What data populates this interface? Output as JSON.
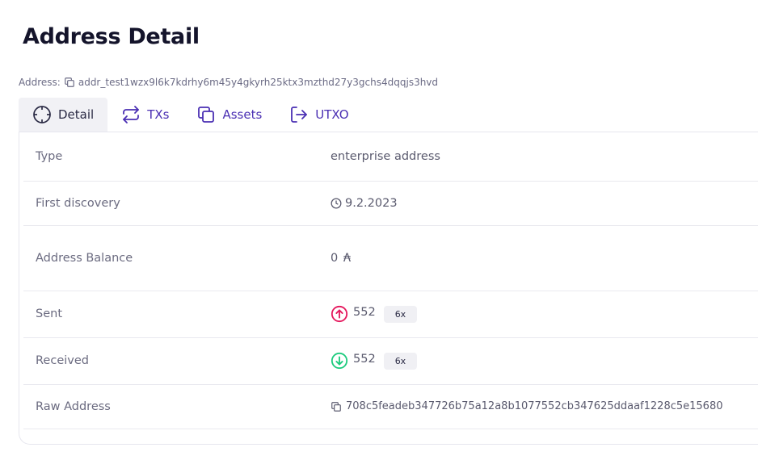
{
  "page": {
    "title": "Address Detail"
  },
  "address": {
    "label": "Address:",
    "value": "addr_test1wzx9l6k7kdrhy6m45y4gkyrh25ktx3mzthd27y3gchs4dqqjs3hvd"
  },
  "tabs": [
    {
      "label": "Detail",
      "icon": "crosshair-icon",
      "active": true
    },
    {
      "label": "TXs",
      "icon": "repeat-icon",
      "active": false
    },
    {
      "label": "Assets",
      "icon": "copy-stack-icon",
      "active": false
    },
    {
      "label": "UTXO",
      "icon": "log-out-icon",
      "active": false
    }
  ],
  "details": {
    "type": {
      "label": "Type",
      "value": "enterprise address"
    },
    "first_discovery": {
      "label": "First discovery",
      "value": "9.2.2023"
    },
    "balance": {
      "label": "Address Balance",
      "value": "0 ₳"
    },
    "sent": {
      "label": "Sent",
      "value": "552",
      "count": "6x"
    },
    "received": {
      "label": "Received",
      "value": "552",
      "count": "6x"
    },
    "raw": {
      "label": "Raw Address",
      "value": "708c5feadeb347726b75a12a8b1077552cb347625ddaaf1228c5e15680"
    }
  },
  "colors": {
    "accent": "#4a2fb3",
    "sent": "#e5195e",
    "received": "#1ecb7e"
  }
}
